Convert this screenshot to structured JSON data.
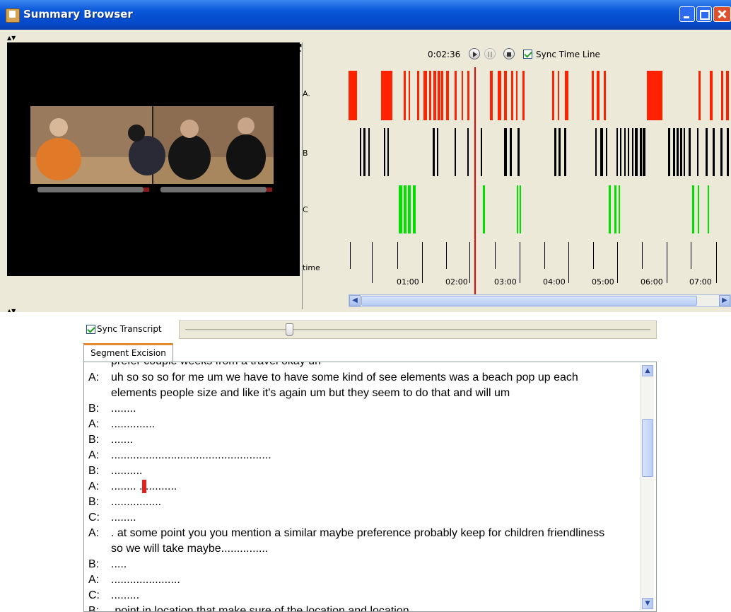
{
  "window": {
    "title": "Summary Browser"
  },
  "player": {
    "time": "0:02:36",
    "sync_timeline_label": "Sync Time Line",
    "sync_timeline_checked": true
  },
  "timeline": {
    "tracks": [
      {
        "label": "A.",
        "color": "#ff2200"
      },
      {
        "label": "B",
        "color": "#000000"
      },
      {
        "label": "C",
        "color": "#00e000"
      },
      {
        "label": "time",
        "color": "#000000"
      }
    ],
    "ticks": [
      "01:00",
      "02:00",
      "03:00",
      "04:00",
      "05:00",
      "06:00",
      "07:00"
    ],
    "playhead_time": "0:02:36",
    "playhead_color": "#ff0000"
  },
  "transcript": {
    "sync_label": "Sync Transcript",
    "sync_checked": true,
    "tab_label": "Segment Excision",
    "top_cut_text": "prefer couple weeks from a travel okay uh",
    "lines": [
      {
        "speaker": "A:",
        "text": "uh so so so for me um we have to have some kind of see elements was a beach pop up each"
      },
      {
        "speaker": "",
        "text": "elements people size and like it's again um but they seem to do that and will um"
      },
      {
        "speaker": "B:",
        "text": "........"
      },
      {
        "speaker": "A:",
        "text": ".............."
      },
      {
        "speaker": "B:",
        "text": "......."
      },
      {
        "speaker": "A:",
        "text": "..................................................."
      },
      {
        "speaker": "B:",
        "text": ".........."
      },
      {
        "speaker": "A:",
        "text": "........ ............"
      },
      {
        "speaker": "B:",
        "text": "................"
      },
      {
        "speaker": "C:",
        "text": "........"
      },
      {
        "speaker": "A:",
        "text": ". at some point you you mention a similar maybe preference probably keep for children friendliness"
      },
      {
        "speaker": "",
        "text": "so we will take maybe..............."
      },
      {
        "speaker": "B:",
        "text": "....."
      },
      {
        "speaker": "A:",
        "text": "......................"
      },
      {
        "speaker": "C:",
        "text": "........."
      }
    ],
    "bottom_cut_text": "B: ... point in location that make sure of the location and location"
  }
}
